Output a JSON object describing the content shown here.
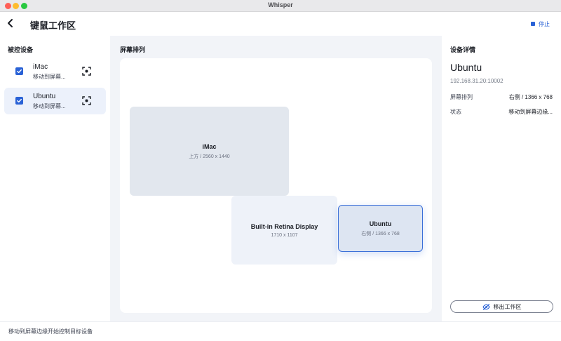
{
  "window": {
    "title": "Whisper"
  },
  "header": {
    "title": "键鼠工作区",
    "stop_label": "停止"
  },
  "sidebar": {
    "title": "被控设备",
    "devices": [
      {
        "name": "iMac",
        "status": "移动到屏幕..."
      },
      {
        "name": "Ubuntu",
        "status": "移动到屏幕..."
      }
    ]
  },
  "main": {
    "title": "屏幕排列",
    "screens": [
      {
        "name": "iMac",
        "resolution": "上方 / 2560 x 1440"
      },
      {
        "name": "Built-in Retina Display",
        "resolution": "1710 x 1107"
      },
      {
        "name": "Ubuntu",
        "resolution": "右侧 / 1366 x 768"
      }
    ]
  },
  "details": {
    "title": "设备详情",
    "device_name": "Ubuntu",
    "ip": "192.168.31.20:10002",
    "rows": [
      {
        "key": "屏幕排列",
        "value": "右侧 / 1366 x 768"
      },
      {
        "key": "状态",
        "value": "移动到屏幕边缘..."
      }
    ],
    "leave_label": "移出工作区"
  },
  "status": {
    "hint": "移动到屏幕边缘开始控制目标设备"
  },
  "colors": {
    "accent": "#2a62d6",
    "selected_bg": "#ecf1fb",
    "panel_bg": "#f2f4f8"
  }
}
